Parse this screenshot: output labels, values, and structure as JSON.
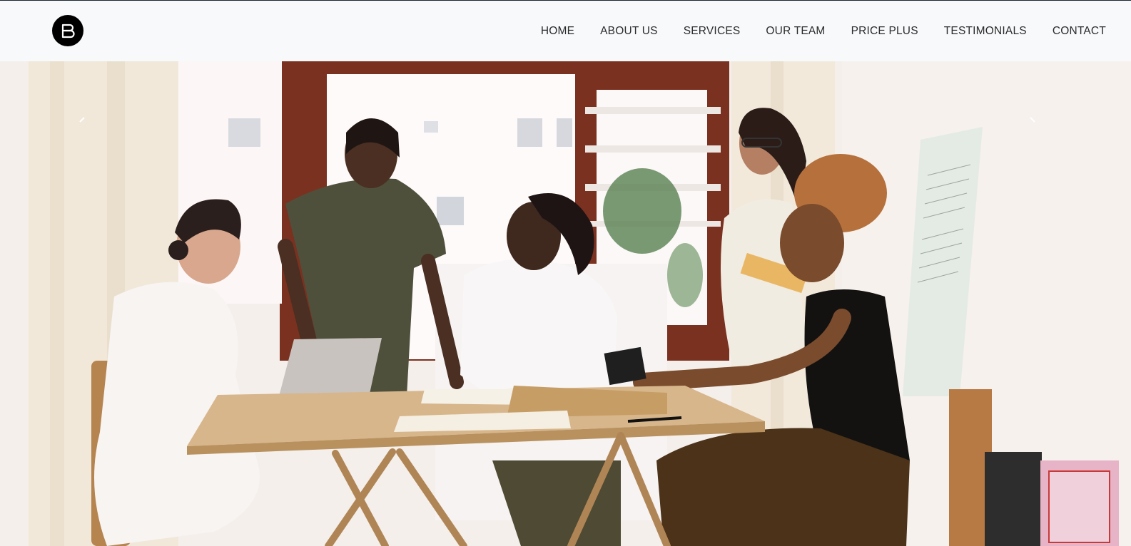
{
  "brand": {
    "logo_icon": "letter-b-logo-icon",
    "logo_bg": "#000000"
  },
  "nav": {
    "items": [
      "HOME",
      "ABOUT US",
      "SERVICES",
      "OUR TEAM",
      "PRICE PLUS",
      "TESTIMONIALS",
      "CONTACT"
    ]
  },
  "hero": {
    "image": "photo-team-meeting-at-table",
    "prev_icon": "chevron-left-icon",
    "next_icon": "chevron-right-icon"
  },
  "colors": {
    "navbar_bg": "#f7f9fb",
    "nav_text": "#2b2b2b",
    "top_line": "#1b2433"
  }
}
